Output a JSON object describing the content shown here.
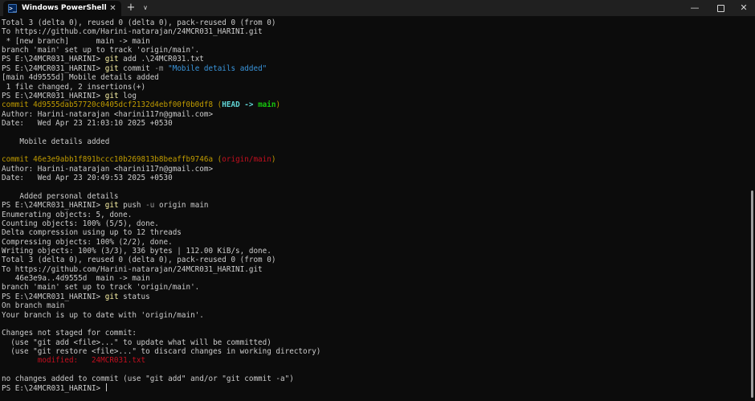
{
  "titlebar": {
    "tab_title": "Windows PowerShell",
    "tab_icon_glyph": ">_",
    "close_tab_glyph": "✕",
    "new_tab_glyph": "+",
    "dropdown_glyph": "∨",
    "minimize_glyph": "—",
    "close_window_glyph": "✕"
  },
  "scrollbar": {
    "position_fraction": 0.45
  },
  "terminal": {
    "lines": [
      [
        {
          "t": "Total 3 (delta 0), reused 0 (delta 0), pack-reused 0 (from 0)",
          "c": ""
        }
      ],
      [
        {
          "t": "To https://github.com/Harini-natarajan/24MCR031_HARINI.git",
          "c": ""
        }
      ],
      [
        {
          "t": " * [new branch]      main -> main",
          "c": ""
        }
      ],
      [
        {
          "t": "branch 'main' set up to track 'origin/main'.",
          "c": ""
        }
      ],
      [
        {
          "t": "PS E:\\24MCR031_HARINI> ",
          "c": ""
        },
        {
          "t": "git",
          "c": "seg-cmd"
        },
        {
          "t": " add .\\24MCR031.txt",
          "c": ""
        }
      ],
      [
        {
          "t": "PS E:\\24MCR031_HARINI> ",
          "c": ""
        },
        {
          "t": "git",
          "c": "seg-cmd"
        },
        {
          "t": " commit ",
          "c": ""
        },
        {
          "t": "-m",
          "c": "seg-param"
        },
        {
          "t": " ",
          "c": ""
        },
        {
          "t": "\"Mobile details added\"",
          "c": "seg-string"
        }
      ],
      [
        {
          "t": "[main 4d9555d] Mobile details added",
          "c": ""
        }
      ],
      [
        {
          "t": " 1 file changed, 2 insertions(+)",
          "c": ""
        }
      ],
      [
        {
          "t": "PS E:\\24MCR031_HARINI> ",
          "c": ""
        },
        {
          "t": "git",
          "c": "seg-cmd"
        },
        {
          "t": " log",
          "c": ""
        }
      ],
      [
        {
          "t": "commit 4d9555dab57720c0405dcf2132d4ebf00f0b0df8 ",
          "c": "seg-yellow"
        },
        {
          "t": "(",
          "c": "seg-yellow"
        },
        {
          "t": "HEAD -> ",
          "c": "seg-bold-cyan"
        },
        {
          "t": "main",
          "c": "seg-bold-green"
        },
        {
          "t": ")",
          "c": "seg-yellow"
        }
      ],
      [
        {
          "t": "Author: Harini-natarajan <harini117n@gmail.com>",
          "c": ""
        }
      ],
      [
        {
          "t": "Date:   Wed Apr 23 21:03:10 2025 +0530",
          "c": ""
        }
      ],
      [
        {
          "t": "",
          "c": ""
        }
      ],
      [
        {
          "t": "    Mobile details added",
          "c": ""
        }
      ],
      [
        {
          "t": "",
          "c": ""
        }
      ],
      [
        {
          "t": "commit 46e3e9abb1f891bccc10b269813b8beaffb9746a ",
          "c": "seg-yellow"
        },
        {
          "t": "(",
          "c": "seg-yellow"
        },
        {
          "t": "origin/main",
          "c": "seg-red"
        },
        {
          "t": ")",
          "c": "seg-yellow"
        }
      ],
      [
        {
          "t": "Author: Harini-natarajan <harini117n@gmail.com>",
          "c": ""
        }
      ],
      [
        {
          "t": "Date:   Wed Apr 23 20:49:53 2025 +0530",
          "c": ""
        }
      ],
      [
        {
          "t": "",
          "c": ""
        }
      ],
      [
        {
          "t": "    Added personal details",
          "c": ""
        }
      ],
      [
        {
          "t": "PS E:\\24MCR031_HARINI> ",
          "c": ""
        },
        {
          "t": "git",
          "c": "seg-cmd"
        },
        {
          "t": " push ",
          "c": ""
        },
        {
          "t": "-u",
          "c": "seg-param"
        },
        {
          "t": " origin main",
          "c": ""
        }
      ],
      [
        {
          "t": "Enumerating objects: 5, done.",
          "c": ""
        }
      ],
      [
        {
          "t": "Counting objects: 100% (5/5), done.",
          "c": ""
        }
      ],
      [
        {
          "t": "Delta compression using up to 12 threads",
          "c": ""
        }
      ],
      [
        {
          "t": "Compressing objects: 100% (2/2), done.",
          "c": ""
        }
      ],
      [
        {
          "t": "Writing objects: 100% (3/3), 336 bytes | 112.00 KiB/s, done.",
          "c": ""
        }
      ],
      [
        {
          "t": "Total 3 (delta 0), reused 0 (delta 0), pack-reused 0 (from 0)",
          "c": ""
        }
      ],
      [
        {
          "t": "To https://github.com/Harini-natarajan/24MCR031_HARINI.git",
          "c": ""
        }
      ],
      [
        {
          "t": "   46e3e9a..4d9555d  main -> main",
          "c": ""
        }
      ],
      [
        {
          "t": "branch 'main' set up to track 'origin/main'.",
          "c": ""
        }
      ],
      [
        {
          "t": "PS E:\\24MCR031_HARINI> ",
          "c": ""
        },
        {
          "t": "git",
          "c": "seg-cmd"
        },
        {
          "t": " status",
          "c": ""
        }
      ],
      [
        {
          "t": "On branch main",
          "c": ""
        }
      ],
      [
        {
          "t": "Your branch is up to date with 'origin/main'.",
          "c": ""
        }
      ],
      [
        {
          "t": "",
          "c": ""
        }
      ],
      [
        {
          "t": "Changes not staged for commit:",
          "c": ""
        }
      ],
      [
        {
          "t": "  (use \"git add <file>...\" to update what will be committed)",
          "c": ""
        }
      ],
      [
        {
          "t": "  (use \"git restore <file>...\" to discard changes in working directory)",
          "c": ""
        }
      ],
      [
        {
          "t": "        ",
          "c": ""
        },
        {
          "t": "modified:   24MCR031.txt",
          "c": "seg-red"
        }
      ],
      [
        {
          "t": "",
          "c": ""
        }
      ],
      [
        {
          "t": "no changes added to commit (use \"git add\" and/or \"git commit -a\")",
          "c": ""
        }
      ],
      [
        {
          "t": "PS E:\\24MCR031_HARINI> ",
          "c": ""
        }
      ]
    ]
  }
}
